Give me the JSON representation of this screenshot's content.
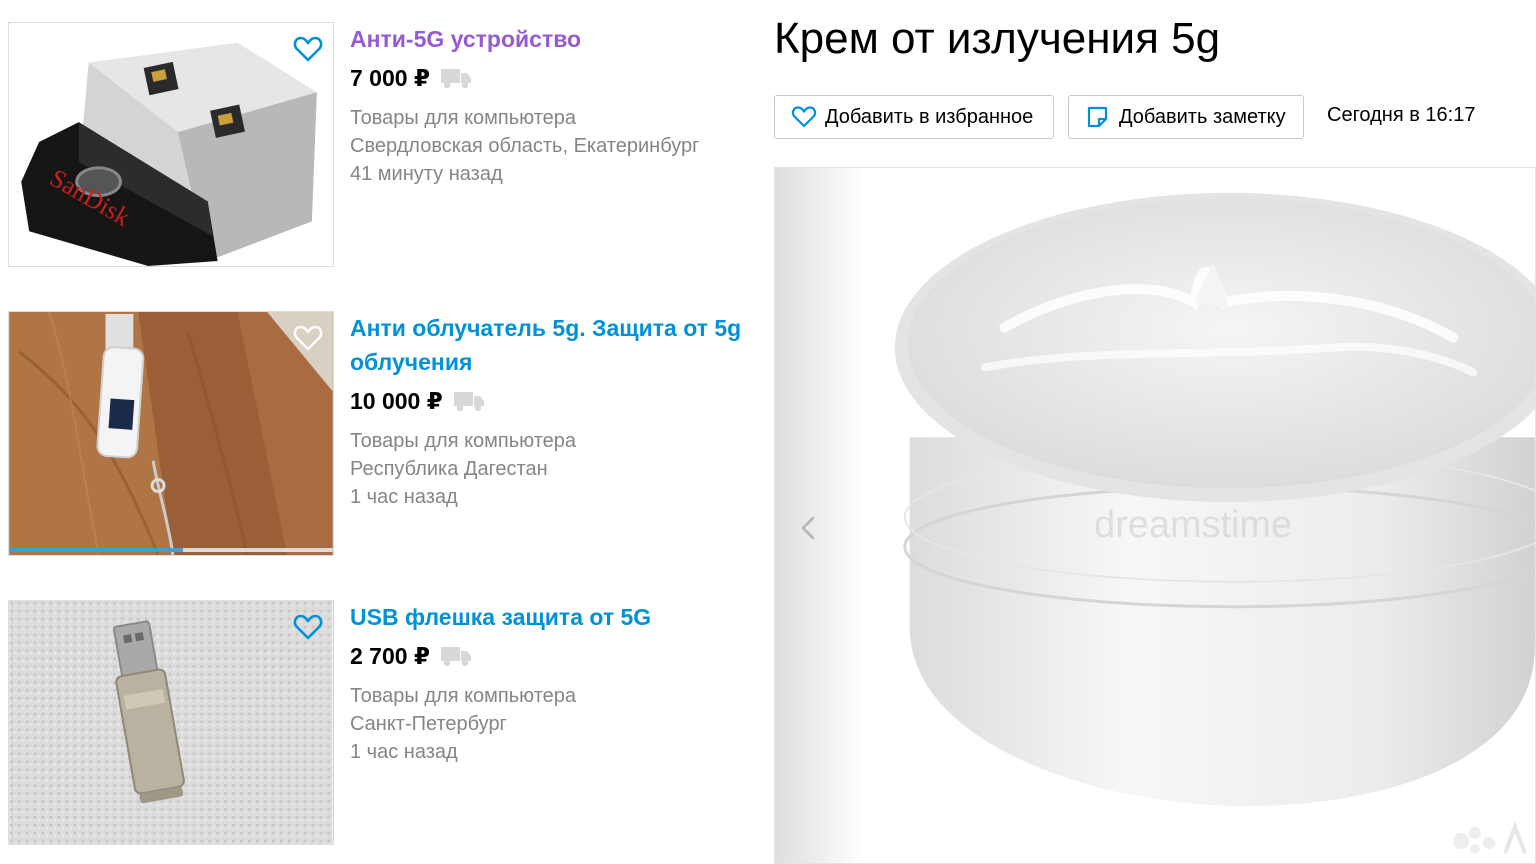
{
  "listings": [
    {
      "title": "Анти-5G устройство",
      "price": "7 000 ₽",
      "category": "Товары для компьютера",
      "location": "Свердловская область, Екатеринбург",
      "time": "41 минуту назад"
    },
    {
      "title": "Анти облучатель 5g. Защита от 5g облучения",
      "price": "10 000 ₽",
      "category": "Товары для компьютера",
      "location": "Республика Дагестан",
      "time": "1 час назад"
    },
    {
      "title": "USB флешка защита от 5G",
      "price": "2 700 ₽",
      "category": "Товары для компьютера",
      "location": "Санкт-Петербург",
      "time": "1 час назад"
    }
  ],
  "thumb_texts": {
    "brand": "SanDisk"
  },
  "ad": {
    "title": "Крем от излучения 5g",
    "favorite_label": "Добавить в избранное",
    "note_label": "Добавить заметку",
    "posted": "Сегодня в 16:17",
    "watermark": "dreamstime"
  },
  "colors": {
    "link": "#0091d9",
    "visited": "#965ad2",
    "meta": "#858585",
    "icon": "#0091d9"
  },
  "icons": {
    "favorite": "heart-icon",
    "note": "note-icon",
    "delivery": "truck-icon",
    "prev": "chevron-left-icon"
  }
}
